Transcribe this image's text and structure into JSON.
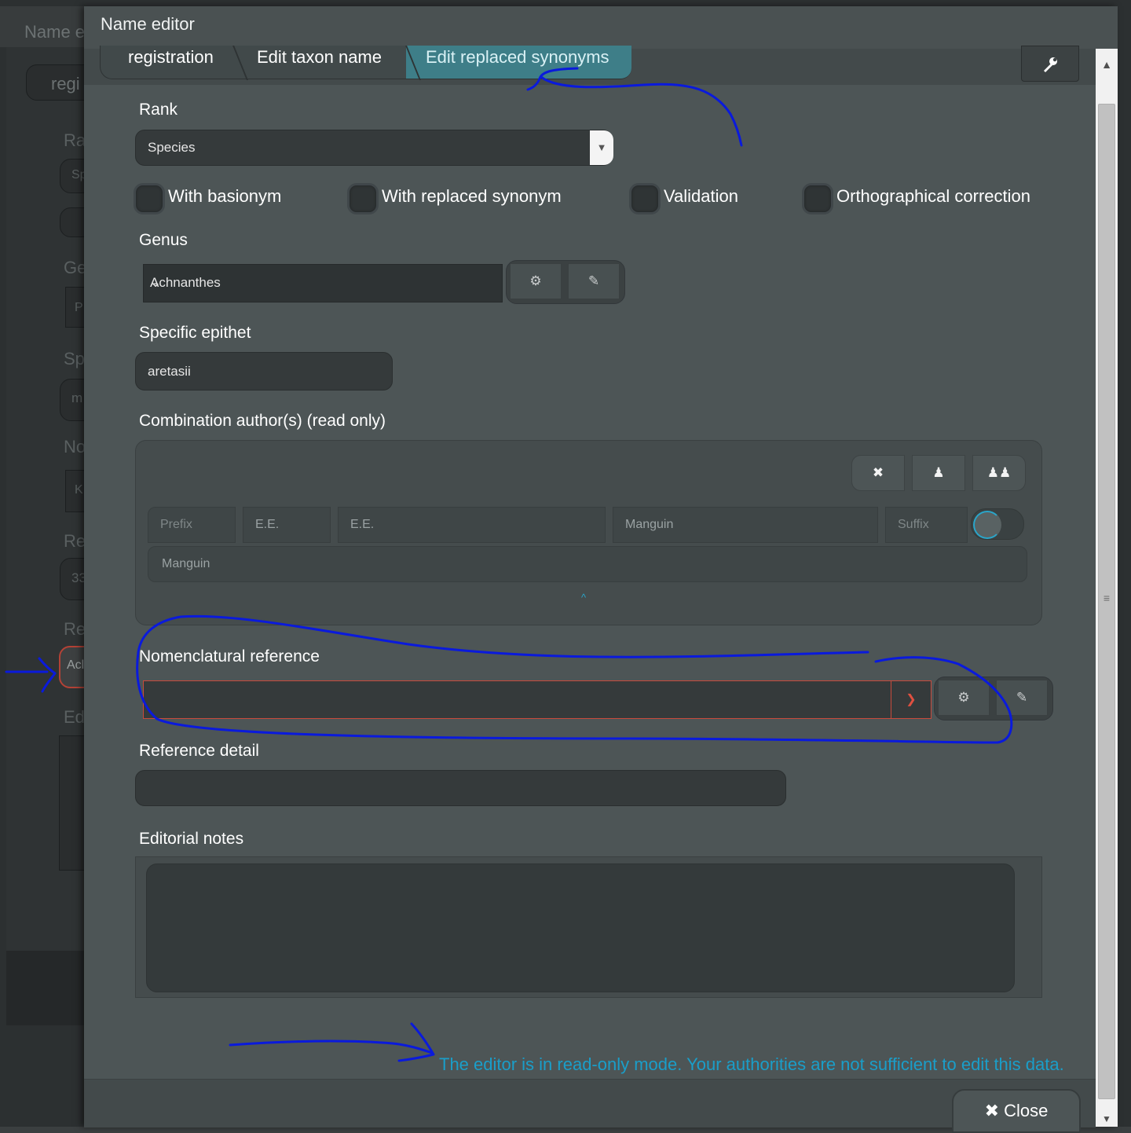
{
  "background_window": {
    "title_fragment": "Name e",
    "fragments": [
      "regi",
      "Ra",
      "Sp",
      "Ge",
      "P",
      "Sp",
      "m",
      "No",
      "K",
      "Re",
      "33",
      "Re",
      "Acl",
      "Ed"
    ]
  },
  "modal": {
    "title": "Name editor",
    "breadcrumbs": [
      "registration",
      "Edit taxon name",
      "Edit replaced synonyms"
    ],
    "wrench_icon": "wrench-icon"
  },
  "form": {
    "rank": {
      "label": "Rank",
      "value": "Species"
    },
    "checkboxes": [
      "With basionym",
      "With replaced synonym",
      "Validation",
      "Orthographical correction"
    ],
    "genus": {
      "label": "Genus",
      "value": "Achnanthes"
    },
    "specific_epithet": {
      "label": "Specific epithet",
      "value": "aretasii"
    },
    "authors": {
      "label": "Combination author(s) (read only)",
      "prefix_placeholder": "Prefix",
      "given1": "E.E.",
      "given2": "E.E.",
      "family": "Manguin",
      "suffix_placeholder": "Suffix",
      "display": "Manguin"
    },
    "nomenclatural_reference": {
      "label": "Nomenclatural reference",
      "value": ""
    },
    "reference_detail": {
      "label": "Reference detail",
      "value": ""
    },
    "editorial_notes": {
      "label": "Editorial notes",
      "value": ""
    }
  },
  "message": "The editor is in read-only mode. Your authorities are not sufficient to edit this data.",
  "footer": {
    "close_label": "Close"
  },
  "colors": {
    "accent": "#1a9ec9",
    "error": "#c94a3c",
    "annotation": "#0a1adc"
  }
}
